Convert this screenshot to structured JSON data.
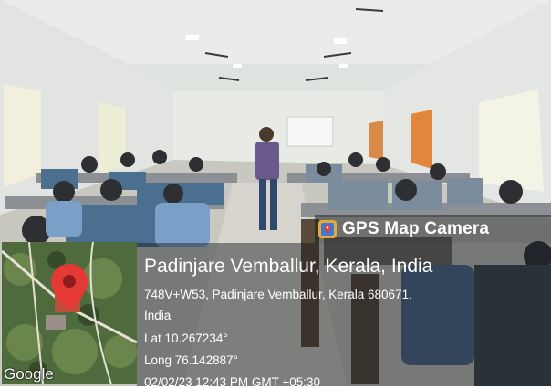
{
  "badge": {
    "icon": "gps-map-camera-icon",
    "label": "GPS Map Camera"
  },
  "location": {
    "title": "Padinjare Vemballur, Kerala, India",
    "address_line1": "748V+W53, Padinjare Vemballur, Kerala 680671,",
    "address_line2": "India",
    "latitude": "Lat 10.267234°",
    "longitude": "Long 76.142887°",
    "timestamp": "02/02/23 12:43 PM GMT +05:30"
  },
  "map": {
    "provider": "Google",
    "pin_color": "#e53935"
  }
}
